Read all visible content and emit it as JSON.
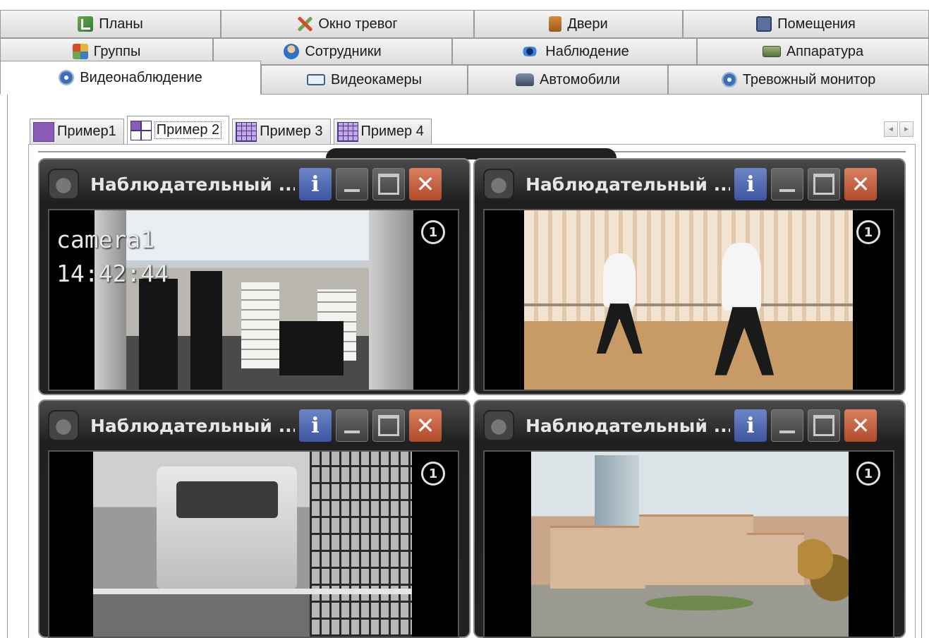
{
  "tabs": {
    "row1": [
      {
        "label": "Планы",
        "icon": "plans-icon"
      },
      {
        "label": "Окно тревог",
        "icon": "alarm-window-icon"
      },
      {
        "label": "Двери",
        "icon": "doors-icon"
      },
      {
        "label": "Помещения",
        "icon": "rooms-icon"
      }
    ],
    "row2": [
      {
        "label": "Группы",
        "icon": "groups-icon"
      },
      {
        "label": "Сотрудники",
        "icon": "employees-icon"
      },
      {
        "label": "Наблюдение",
        "icon": "eye-icon"
      },
      {
        "label": "Аппаратура",
        "icon": "hardware-icon"
      }
    ],
    "row3": [
      {
        "label": "Видеонаблюдение",
        "icon": "video-surveillance-icon",
        "active": true
      },
      {
        "label": "Видеокамеры",
        "icon": "video-camera-icon"
      },
      {
        "label": "Автомобили",
        "icon": "car-icon"
      },
      {
        "label": "Тревожный монитор",
        "icon": "alarm-monitor-icon"
      }
    ]
  },
  "layouts": [
    {
      "label": "Пример1",
      "icon": "layout-1x1-icon"
    },
    {
      "label": "Пример 2",
      "icon": "layout-2x2-icon",
      "active": true
    },
    {
      "label": "Пример 3",
      "icon": "layout-grid-icon"
    },
    {
      "label": "Пример 4",
      "icon": "layout-grid-icon"
    }
  ],
  "nav": {
    "prev": "◄",
    "next": "►"
  },
  "windows": [
    {
      "title": "Наблюдательный ...",
      "camera_name": "camera1",
      "time": "14:42:44",
      "badge": "1",
      "info": "i",
      "close": "✕"
    },
    {
      "title": "Наблюдательный ...",
      "badge": "1",
      "info": "i",
      "close": "✕"
    },
    {
      "title": "Наблюдательный ...",
      "badge": "1",
      "info": "i",
      "close": "✕"
    },
    {
      "title": "Наблюдательный ...",
      "badge": "1",
      "info": "i",
      "close": "✕"
    }
  ],
  "colors": {
    "close_button": "#b24a2c",
    "info_button": "#3d55a0",
    "window_frame": "#1f1f1f"
  }
}
